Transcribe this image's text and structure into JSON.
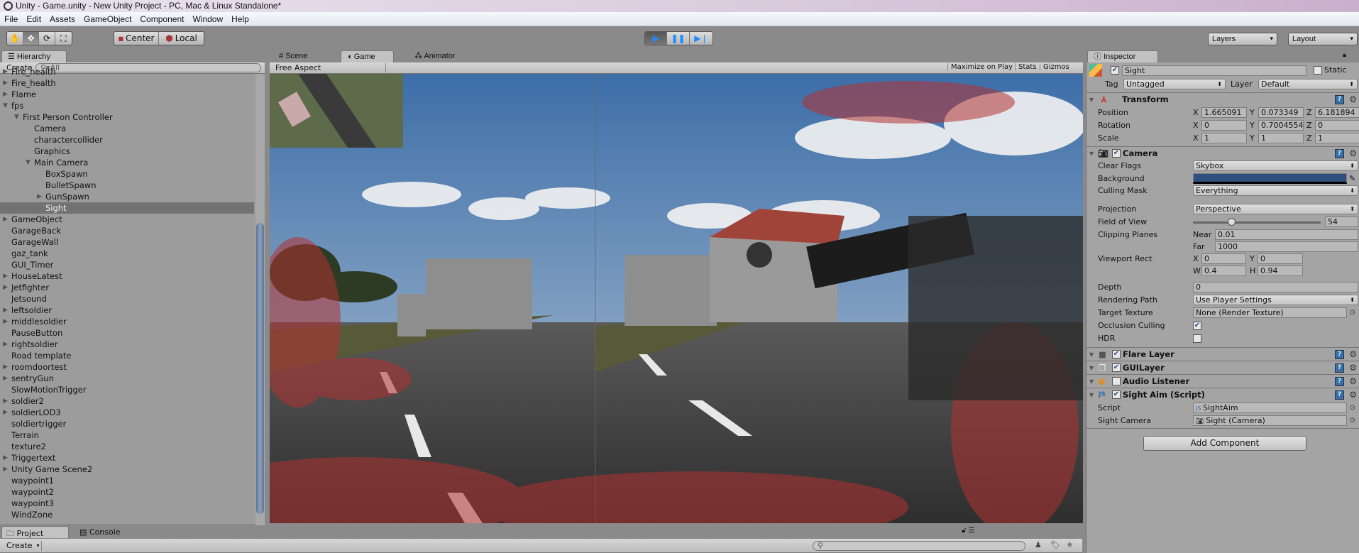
{
  "window": {
    "title": "Unity - Game.unity - New Unity Project - PC, Mac & Linux Standalone*"
  },
  "menu": [
    "File",
    "Edit",
    "Assets",
    "GameObject",
    "Component",
    "Window",
    "Help"
  ],
  "toolbar": {
    "tools": [
      "hand-tool",
      "move-tool",
      "rotate-tool",
      "scale-tool"
    ],
    "pivot": "Center",
    "space": "Local",
    "layers": "Layers",
    "layout": "Layout",
    "play_state": "playing"
  },
  "hierarchy": {
    "tab": "Hierarchy",
    "create": "Create",
    "search_placeholder": "All",
    "items": [
      {
        "label": "Fire_health",
        "depth": 0,
        "arrow": "right"
      },
      {
        "label": "Fire_health",
        "depth": 0,
        "arrow": "right"
      },
      {
        "label": "Flame",
        "depth": 0,
        "arrow": "right"
      },
      {
        "label": "fps",
        "depth": 0,
        "arrow": "down"
      },
      {
        "label": "First Person Controller",
        "depth": 1,
        "arrow": "down"
      },
      {
        "label": "Camera",
        "depth": 2,
        "arrow": ""
      },
      {
        "label": "charactercollider",
        "depth": 2,
        "arrow": ""
      },
      {
        "label": "Graphics",
        "depth": 2,
        "arrow": ""
      },
      {
        "label": "Main Camera",
        "depth": 2,
        "arrow": "down"
      },
      {
        "label": "BoxSpawn",
        "depth": 3,
        "arrow": ""
      },
      {
        "label": "BulletSpawn",
        "depth": 3,
        "arrow": ""
      },
      {
        "label": "GunSpawn",
        "depth": 3,
        "arrow": "right"
      },
      {
        "label": "Sight",
        "depth": 3,
        "arrow": "",
        "selected": true
      },
      {
        "label": "GameObject",
        "depth": 0,
        "arrow": "right"
      },
      {
        "label": "GarageBack",
        "depth": 0,
        "arrow": ""
      },
      {
        "label": "GarageWall",
        "depth": 0,
        "arrow": ""
      },
      {
        "label": "gaz_tank",
        "depth": 0,
        "arrow": ""
      },
      {
        "label": "GUI_Timer",
        "depth": 0,
        "arrow": ""
      },
      {
        "label": "HouseLatest",
        "depth": 0,
        "arrow": "right"
      },
      {
        "label": "Jetfighter",
        "depth": 0,
        "arrow": "right"
      },
      {
        "label": "Jetsound",
        "depth": 0,
        "arrow": ""
      },
      {
        "label": "leftsoldier",
        "depth": 0,
        "arrow": "right"
      },
      {
        "label": "middlesoldier",
        "depth": 0,
        "arrow": "right"
      },
      {
        "label": "PauseButton",
        "depth": 0,
        "arrow": ""
      },
      {
        "label": "rightsoldier",
        "depth": 0,
        "arrow": "right"
      },
      {
        "label": "Road template",
        "depth": 0,
        "arrow": ""
      },
      {
        "label": "roomdoortest",
        "depth": 0,
        "arrow": "right"
      },
      {
        "label": "sentryGun",
        "depth": 0,
        "arrow": "right"
      },
      {
        "label": "SlowMotionTrigger",
        "depth": 0,
        "arrow": ""
      },
      {
        "label": "soldier2",
        "depth": 0,
        "arrow": "right"
      },
      {
        "label": "soldierLOD3",
        "depth": 0,
        "arrow": "right"
      },
      {
        "label": "soldiertrigger",
        "depth": 0,
        "arrow": ""
      },
      {
        "label": "Terrain",
        "depth": 0,
        "arrow": ""
      },
      {
        "label": "texture2",
        "depth": 0,
        "arrow": ""
      },
      {
        "label": "Triggertext",
        "depth": 0,
        "arrow": "right"
      },
      {
        "label": "Unity Game Scene2",
        "depth": 0,
        "arrow": "right"
      },
      {
        "label": "waypoint1",
        "depth": 0,
        "arrow": ""
      },
      {
        "label": "waypoint2",
        "depth": 0,
        "arrow": ""
      },
      {
        "label": "waypoint3",
        "depth": 0,
        "arrow": ""
      },
      {
        "label": "WindZone",
        "depth": 0,
        "arrow": ""
      }
    ]
  },
  "center_tabs": {
    "scene": "Scene",
    "game": "Game",
    "animator": "Animator"
  },
  "game_bar": {
    "aspect": "Free Aspect",
    "maximize": "Maximize on Play",
    "stats": "Stats",
    "gizmos": "Gizmos"
  },
  "inspector": {
    "tab": "Inspector",
    "name": "Sight",
    "static": "Static",
    "tag_label": "Tag",
    "tag": "Untagged",
    "layer_label": "Layer",
    "layer": "Default",
    "transform": {
      "title": "Transform",
      "position_label": "Position",
      "rotation_label": "Rotation",
      "scale_label": "Scale",
      "position": {
        "x": "1.665091",
        "y": "0.073349",
        "z": "6.181894"
      },
      "rotation": {
        "x": "0",
        "y": "0.7004554",
        "z": "0"
      },
      "scale": {
        "x": "1",
        "y": "1",
        "z": "1"
      }
    },
    "camera": {
      "title": "Camera",
      "clear_flags_label": "Clear Flags",
      "clear_flags": "Skybox",
      "background_label": "Background",
      "background_color": "#2f4f7f",
      "culling_mask_label": "Culling Mask",
      "culling_mask": "Everything",
      "projection_label": "Projection",
      "projection": "Perspective",
      "fov_label": "Field of View",
      "fov": "54",
      "fov_fraction": 0.3,
      "clipping_label": "Clipping Planes",
      "near_label": "Near",
      "near": "0.01",
      "far_label": "Far",
      "far": "1000",
      "viewport_label": "Viewport Rect",
      "vx": "0",
      "vy": "0",
      "vw": "0.4",
      "vh": "0.94",
      "depth_label": "Depth",
      "depth": "0",
      "rendering_label": "Rendering Path",
      "rendering": "Use Player Settings",
      "target_label": "Target Texture",
      "target": "None (Render Texture)",
      "occlusion_label": "Occlusion Culling",
      "hdr_label": "HDR"
    },
    "flare": "Flare Layer",
    "guilayer": "GUILayer",
    "audio": "Audio Listener",
    "sightaim": {
      "title": "Sight Aim (Script)",
      "script_label": "Script",
      "script": "SightAim",
      "camera_label": "Sight Camera",
      "camera": "Sight (Camera)"
    },
    "add_component": "Add Component"
  },
  "bottom": {
    "project": "Project",
    "console": "Console",
    "create": "Create"
  }
}
